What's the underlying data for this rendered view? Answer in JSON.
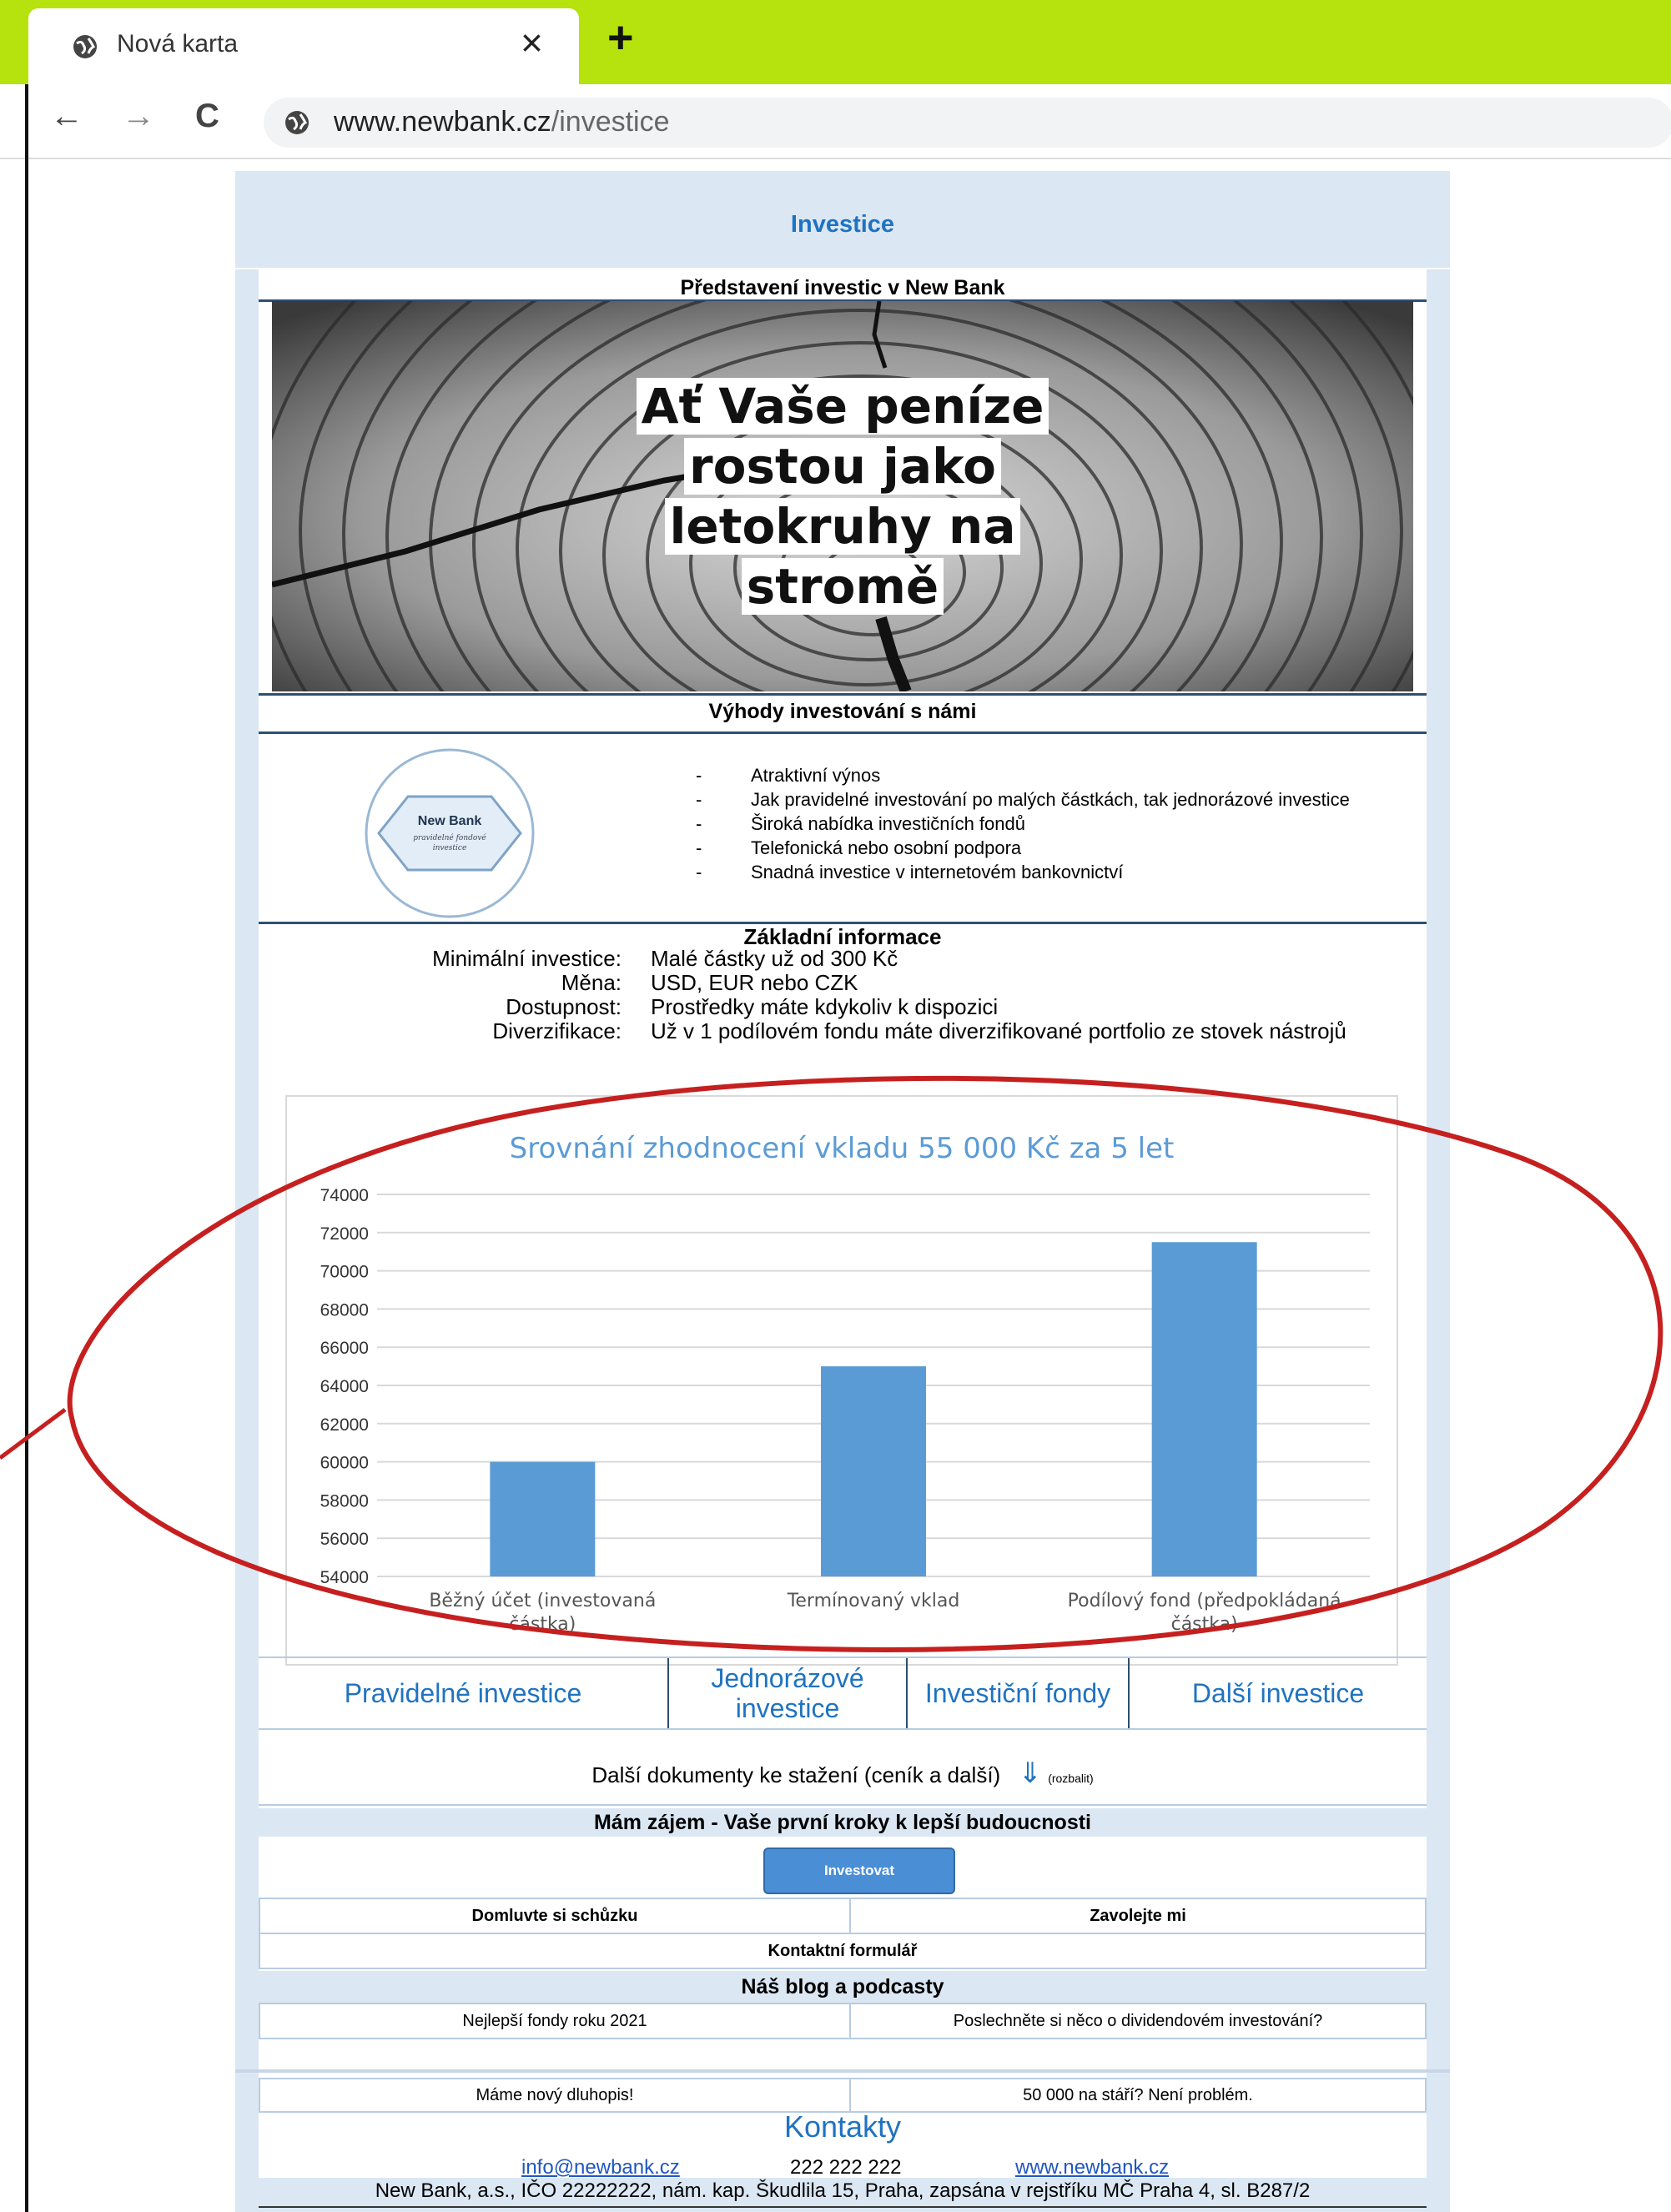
{
  "browser": {
    "tab_title": "Nová karta",
    "tab_close": "×",
    "new_tab": "+",
    "back": "←",
    "forward": "→",
    "reload": "C",
    "url_domain": "www.newbank.cz",
    "url_path": "/investice"
  },
  "page": {
    "title": "Investice",
    "intro_heading": "Představení investic v New Bank",
    "hero_lines": [
      "Ať Vaše peníze",
      "rostou jako",
      "letokruhy na",
      "stromě"
    ],
    "benefits_heading": "Výhody investování s námi",
    "logo": {
      "name": "New Bank",
      "tagline1": "pravidelné fondové",
      "tagline2": "investice"
    },
    "benefits": [
      "Atraktivní výnos",
      "Jak pravidelné investování po malých částkách, tak jednorázové investice",
      "Široká nabídka investičních fondů",
      "Telefonická nebo osobní podpora",
      "Snadná investice v internetovém bankovnictví"
    ],
    "basic_info_heading": "Základní informace",
    "basic_info": [
      {
        "label": "Minimální investice:",
        "value": "Malé částky už od 300 Kč"
      },
      {
        "label": "Měna:",
        "value": "USD, EUR nebo CZK"
      },
      {
        "label": "Dostupnost:",
        "value": "Prostředky máte kdykoliv k dispozici"
      },
      {
        "label": "Diverzifikace:",
        "value": "Už v 1 podílovém fondu máte diverzifikované portfolio ze stovek nástrojů"
      }
    ],
    "links": [
      "Pravidelné investice",
      "Jednorázové investice",
      "Investiční fondy",
      "Další investice"
    ],
    "download_text": "Další dokumenty ke stažení (ceník a další)",
    "download_arrow": "⇓",
    "download_toggle": "(rozbalit)",
    "interest_heading": "Mám zájem - Vaše první kroky k lepší budoucnosti",
    "invest_button": "Investovat",
    "meeting": "Domluvte si schůzku",
    "call_me": "Zavolejte mi",
    "contact_form": "Kontaktní formulář",
    "blog_heading": "Náš blog a podcasty",
    "blog": [
      "Nejlepší fondy roku 2021",
      "Poslechněte si něco o dividendovém investování?",
      "Máme nový dluhopis!",
      "50 000 na stáří? Není problém."
    ],
    "contacts_title": "Kontakty",
    "email": "info@newbank.cz",
    "phone": "222 222 222",
    "website": "www.newbank.cz",
    "footer": "New Bank, a.s., IČO 22222222, nám. kap. Škudlila 15, Praha, zapsána v rejstříku MČ Praha 4, sl. B287/2"
  },
  "colors": {
    "accent_blue": "#1f73c1",
    "bar_blue": "#5b9bd5",
    "page_bg": "#dbe7f3",
    "annotation_red": "#c5201f",
    "tab_strip": "#b6e20d"
  },
  "chart_data": {
    "type": "bar",
    "title": "Srovnání zhodnocení vkladu 55 000 Kč za 5 let",
    "categories": [
      "Běžný účet (investovaná částka)",
      "Termínovaný vklad",
      "Podílový fond (předpokládaná částka)"
    ],
    "values": [
      60000,
      65000,
      71500
    ],
    "ylim": [
      54000,
      74000
    ],
    "yticks": [
      54000,
      56000,
      58000,
      60000,
      62000,
      64000,
      66000,
      68000,
      70000,
      72000,
      74000
    ],
    "grid": true,
    "legend": "none"
  }
}
